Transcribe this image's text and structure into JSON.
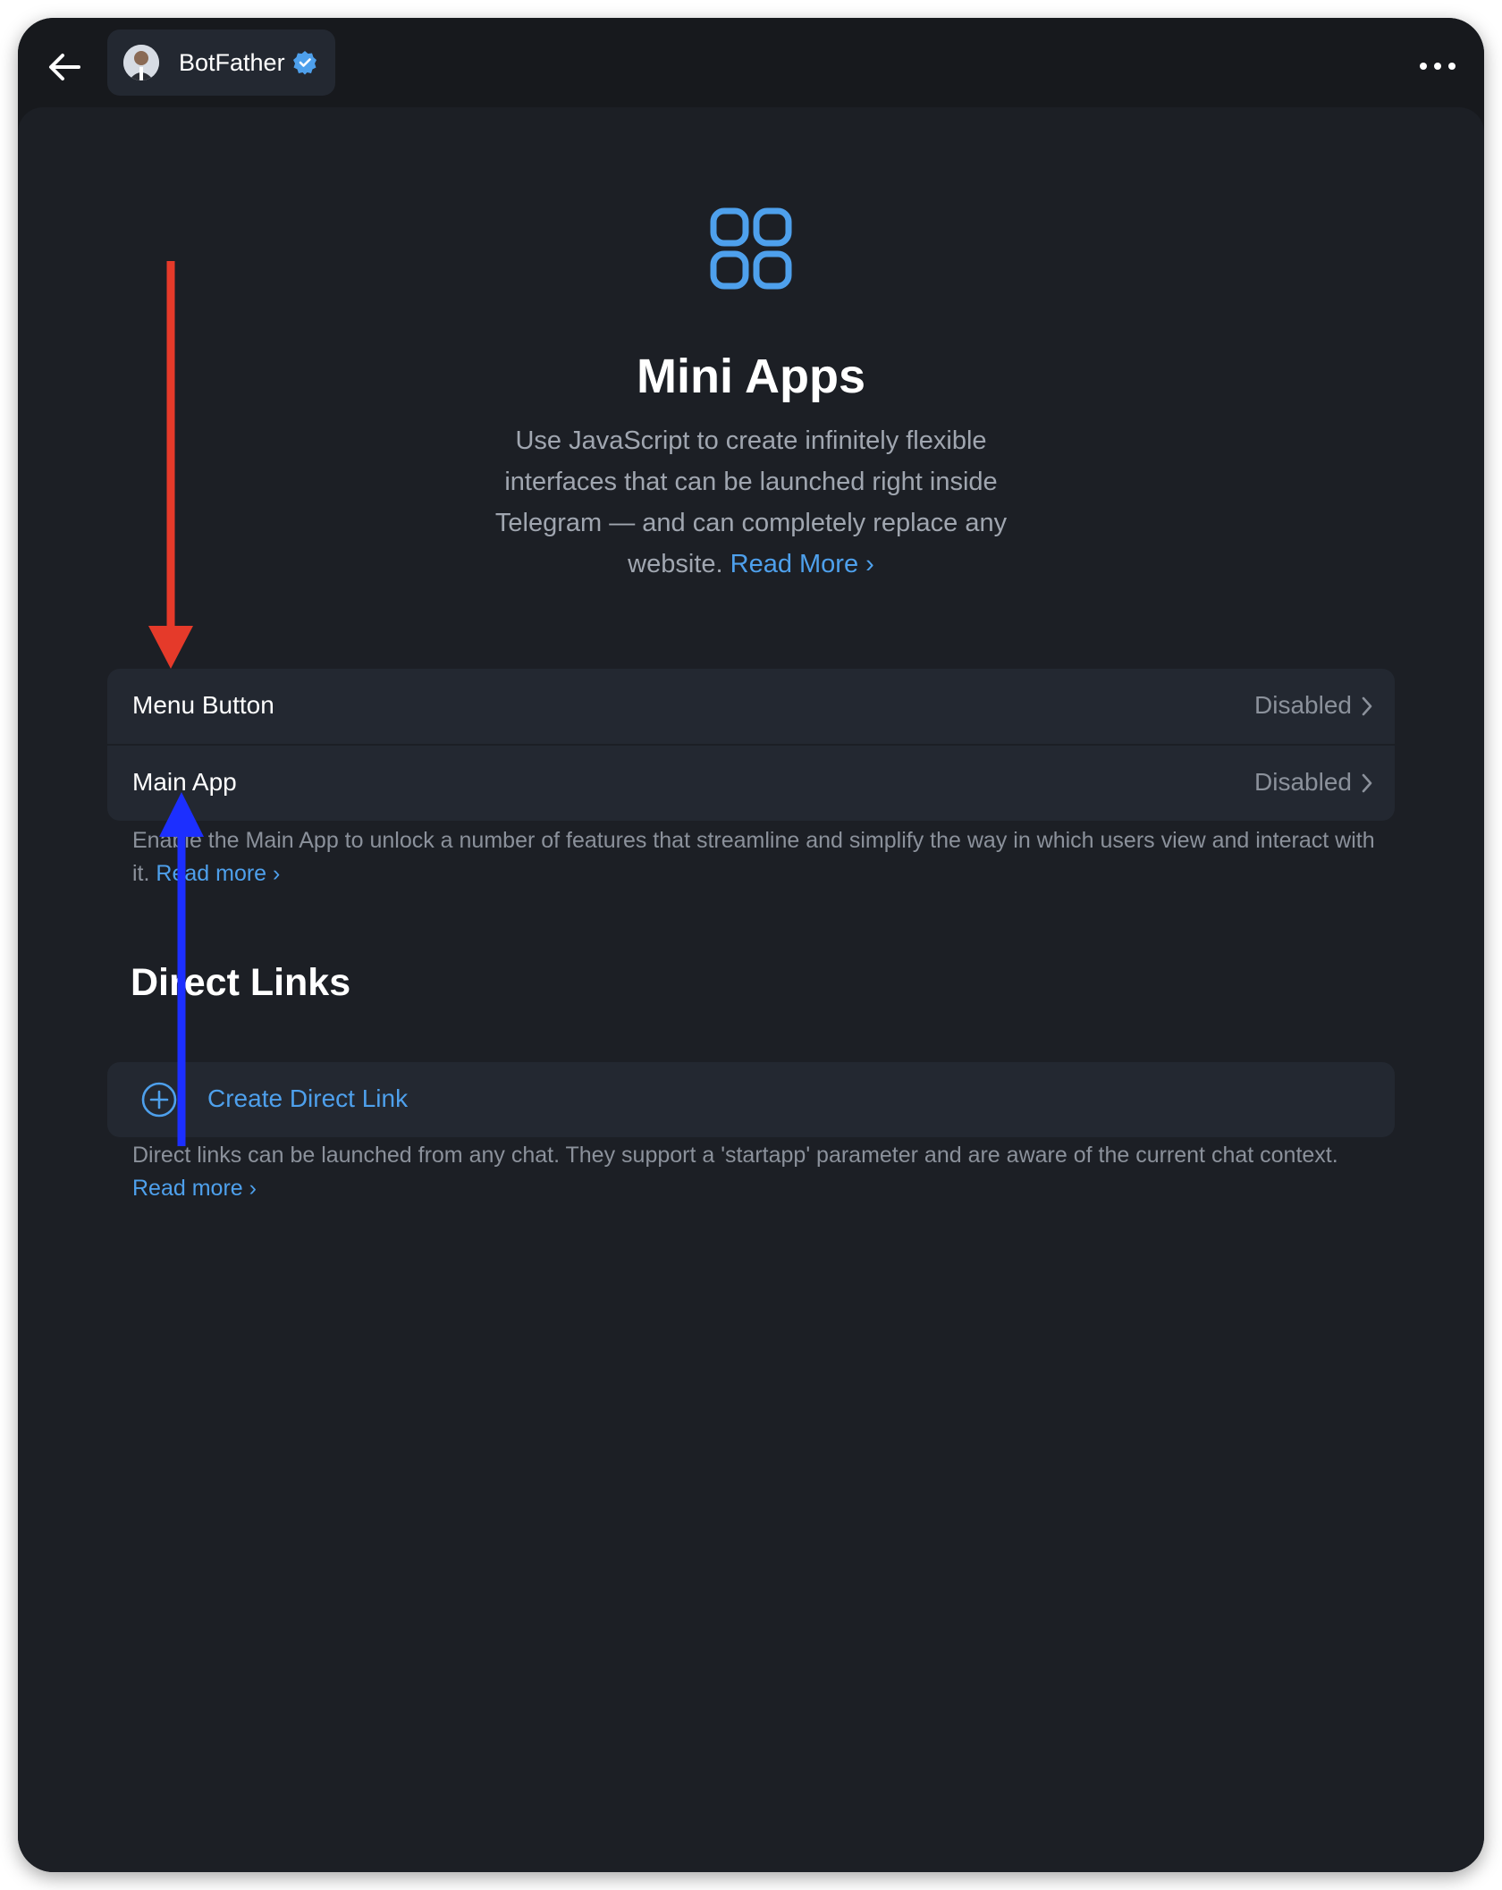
{
  "header": {
    "back_icon": "arrow-left-icon",
    "chat_name": "BotFather",
    "verified_icon": "verified-badge-icon",
    "more_icon": "more-dots-icon"
  },
  "hero": {
    "icon": "grid-apps-icon",
    "title": "Mini Apps",
    "description": "Use JavaScript to create infinitely flexible interfaces that can be launched right inside Telegram — and can completely replace any website.",
    "read_more": "Read More"
  },
  "settings": {
    "items": [
      {
        "label": "Menu Button",
        "value": "Disabled"
      },
      {
        "label": "Main App",
        "value": "Disabled"
      }
    ],
    "footnote": "Enable the Main App to unlock a number of features that streamline and simplify the way in which users view and interact with it.",
    "read_more": "Read more"
  },
  "direct_links": {
    "title": "Direct Links",
    "create_label": "Create Direct Link",
    "footnote": "Direct links can be launched from any chat. They support a 'startapp' parameter and are aware of the current chat context.",
    "read_more": "Read more"
  },
  "colors": {
    "background": "#1c1f25",
    "card": "#232831",
    "accent": "#4ea0ec",
    "annotation_red": "#e53a2a",
    "annotation_blue": "#1c2fff"
  }
}
